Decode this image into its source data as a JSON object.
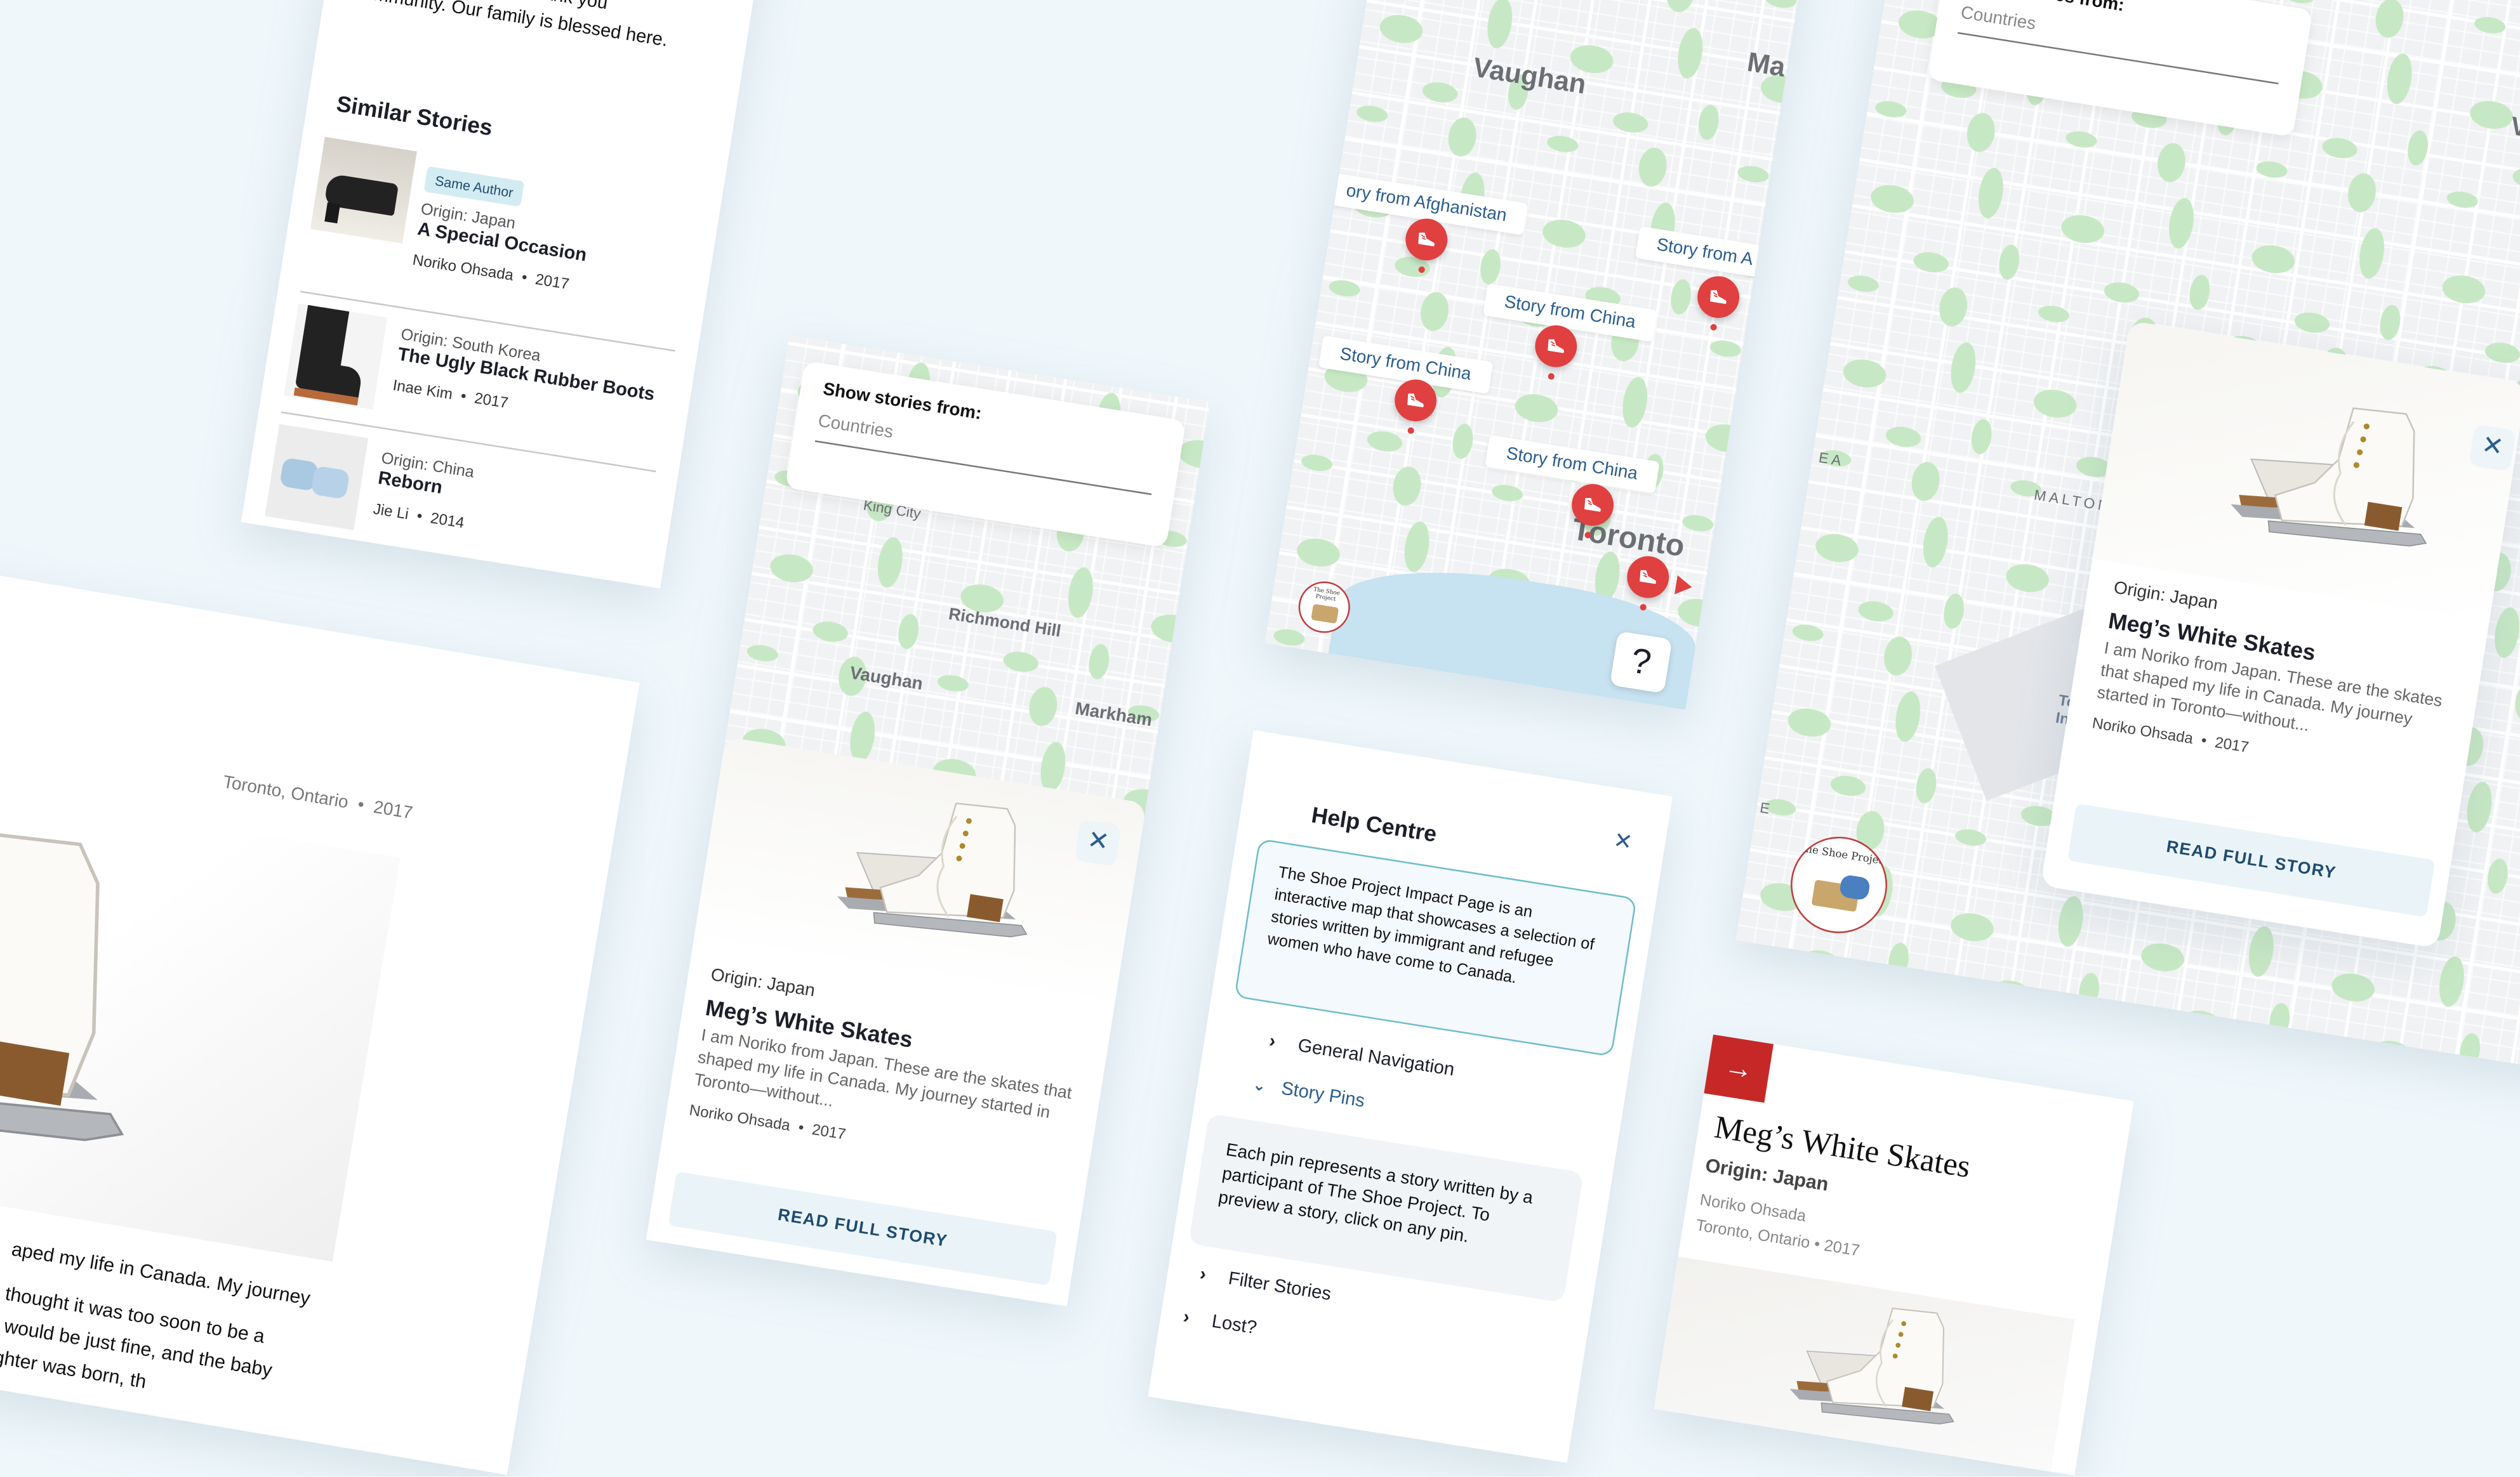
{
  "colors": {
    "background": "#eff7fb",
    "pin_red": "#e04040",
    "accent_blue": "#2a5d8f",
    "teal_border": "#6fbccc",
    "brand_red": "#c62828",
    "button_bg": "#eaf4f8"
  },
  "similar_card": {
    "body_partial": "And, thank you",
    "body_text": "community. Our family is blessed here.",
    "heading": "Similar Stories",
    "items": [
      {
        "badge": "Same Author",
        "origin": "Origin: Japan",
        "title": "A Special Occasion",
        "meta": "Noriko Ohsada  •  2017",
        "image": "black-wedge-shoes"
      },
      {
        "origin": "Origin: South Korea",
        "title": "The Ugly Black Rubber Boots",
        "meta": "Inae Kim  •  2017",
        "image": "black-rubber-boots"
      },
      {
        "origin": "Origin: China",
        "title": "Reborn",
        "meta": "Jie Li  •  2014",
        "image": "blue-baby-booties"
      }
    ]
  },
  "story_page_large": {
    "meta": "Toronto, Ontario  •  2017",
    "lines": [
      "aped my life in Canada. My journey",
      "thought it was too soon to be a",
      "it would be just fine, and the baby",
      "ughter was born, th"
    ]
  },
  "map_preview_card": {
    "filter": {
      "label": "Show stories from:",
      "placeholder": "Countries"
    },
    "map_labels": {
      "king_city": "King City",
      "richmond_hill": "Richmond Hill",
      "vaughan": "Vaughan",
      "markham": "Markham"
    },
    "story": {
      "origin": "Origin: Japan",
      "title": "Meg’s White Skates",
      "excerpt": "I am Noriko from Japan. These are the skates that shaped my life in Canada. My journey started in Toronto—without...",
      "meta": "Noriko Ohsada  •  2017",
      "button": "READ FULL STORY",
      "close": "✕"
    }
  },
  "pin_map": {
    "map_labels": {
      "vaughan": "Vaughan",
      "toronto": "Toronto",
      "markham_partial": "Ma"
    },
    "pin_labels": [
      "ory from Afghanistan",
      "Story from China",
      "Story from China",
      "Story from China",
      "Story from A"
    ],
    "help_button": "?",
    "logo_text": "The Shoe Project"
  },
  "help_centre": {
    "title": "Help Centre",
    "close": "✕",
    "intro": "The Shoe Project Impact Page is an interactive map that showcases a selection of stories written by immigrant and refugee women who have come to Canada.",
    "sections": [
      {
        "label": "General Navigation",
        "expanded": false
      },
      {
        "label": "Story Pins",
        "expanded": true,
        "body": "Each pin represents a story written by a participant of The Shoe Project. To preview a story, click on any pin."
      },
      {
        "label": "Filter Stories",
        "expanded": false
      },
      {
        "label": "Lost?",
        "expanded": false
      }
    ]
  },
  "wide_map": {
    "filter": {
      "label": "Show stories from:",
      "placeholder": "Countries"
    },
    "map_labels": {
      "malton": "MALTON",
      "ea": "EA",
      "airport_1": "Toro",
      "airport_2": "Intern",
      "v": "V",
      "e": "E"
    },
    "logo_text": "The Shoe Project",
    "story": {
      "origin": "Origin: Japan",
      "title": "Meg’s White Skates",
      "excerpt": "I am Noriko from Japan. These are the skates that shaped my life in Canada. My journey started in Toronto—without...",
      "meta": "Noriko Ohsada  •  2017",
      "button": "READ FULL STORY",
      "close": "✕"
    }
  },
  "story_detail": {
    "arrow": "→",
    "title": "Meg’s White Skates",
    "origin": "Origin: Japan",
    "author": "Noriko Ohsada",
    "location": "Toronto, Ontario • 2017"
  }
}
